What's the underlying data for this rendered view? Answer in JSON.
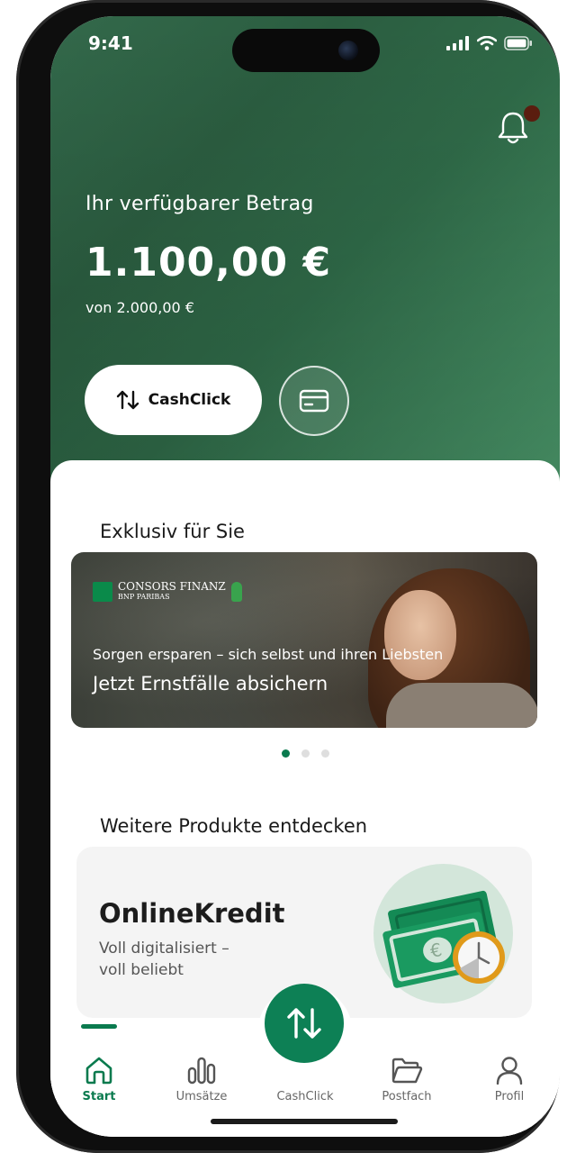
{
  "status_bar": {
    "time": "9:41"
  },
  "hero": {
    "available_label": "Ihr verfügbarer Betrag",
    "amount": "1.100,00 €",
    "of_amount": "von 2.000,00 €",
    "cashclick_button": "CashClick",
    "notification_dot_color": "#5a1d0f"
  },
  "exclusive": {
    "title": "Exklusiv für Sie",
    "promo": {
      "brand": "CONSORS FINANZ",
      "brand_sub": "BNP PARIBAS",
      "subtitle": "Sorgen ersparen – sich selbst und ihren Liebsten",
      "headline": "Jetzt Ernstfälle absichern"
    },
    "carousel": {
      "pages": 3,
      "active": 1
    }
  },
  "more_products": {
    "title": "Weitere Produkte entdecken",
    "card": {
      "title": "OnlineKredit",
      "description": "Voll digitalisiert –\nvoll beliebt"
    }
  },
  "tabbar": {
    "items": [
      {
        "label": "Start",
        "icon": "home-icon",
        "active": true
      },
      {
        "label": "Umsätze",
        "icon": "bar-chart-icon",
        "active": false
      },
      {
        "label": "CashClick",
        "icon": "transfer-arrows-icon",
        "active": false
      },
      {
        "label": "Postfach",
        "icon": "folder-icon",
        "active": false
      },
      {
        "label": "Profil",
        "icon": "person-icon",
        "active": false
      }
    ]
  },
  "colors": {
    "brand_green": "#0d8055",
    "accent_green": "#0a7a4e"
  }
}
